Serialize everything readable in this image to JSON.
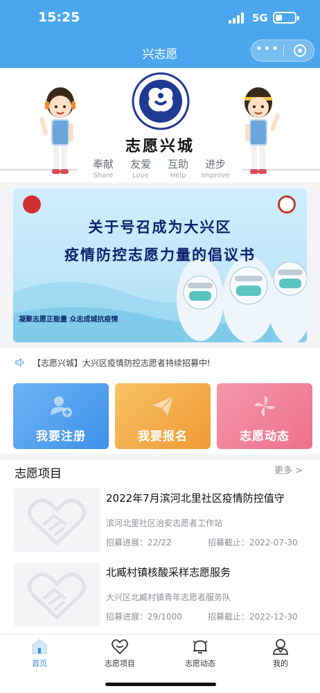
{
  "status_bar": {
    "time": "15:25",
    "network": "5G"
  },
  "title_bar": {
    "title": "兴志愿",
    "more_icon": "more-dots-icon",
    "close_icon": "target-close-icon"
  },
  "hero": {
    "title": "志愿兴城",
    "values": [
      {
        "cn": "奉献",
        "en": "Share"
      },
      {
        "cn": "友爱",
        "en": "Love"
      },
      {
        "cn": "互助",
        "en": "Help"
      },
      {
        "cn": "进步",
        "en": "Improve"
      }
    ]
  },
  "banner": {
    "line1": "关于号召成为大兴区",
    "line2": "疫情防控志愿力量的倡议书",
    "slogan": "凝聚志愿正能量 众志成城抗疫情"
  },
  "notice": {
    "text": "【志愿兴城】大兴区疫情防控志愿者持续招募中!"
  },
  "actions": [
    {
      "label": "我要注册",
      "icon": "add-user-icon",
      "color": "#4f9ff0"
    },
    {
      "label": "我要报名",
      "icon": "paper-plane-icon",
      "color": "#f3ad49"
    },
    {
      "label": "志愿动态",
      "icon": "pinwheel-icon",
      "color": "#f07d96"
    }
  ],
  "projects": {
    "title": "志愿项目",
    "more": "更多 >",
    "items": [
      {
        "title": "2022年7月滨河北里社区疫情防控值守",
        "org": "滨河北里社区治安志愿者工作站",
        "progress_label": "招募进展：22/22",
        "deadline_label": "招募截止：2022-07-30"
      },
      {
        "title": "北臧村镇核酸采样志愿服务",
        "org": "大兴区北臧村镇青年志愿者服务队",
        "progress_label": "招募进展：29/1000",
        "deadline_label": "招募截止：2022-12-30"
      }
    ]
  },
  "tabbar": {
    "tabs": [
      {
        "label": "首页",
        "icon": "home-icon",
        "active": true
      },
      {
        "label": "志愿项目",
        "icon": "heart-icon",
        "active": false
      },
      {
        "label": "志愿动态",
        "icon": "bell-icon",
        "active": false
      },
      {
        "label": "我的",
        "icon": "profile-icon",
        "active": false
      }
    ]
  },
  "colors": {
    "primary": "#4aa7ee",
    "active_tab": "#3d8fe0"
  }
}
